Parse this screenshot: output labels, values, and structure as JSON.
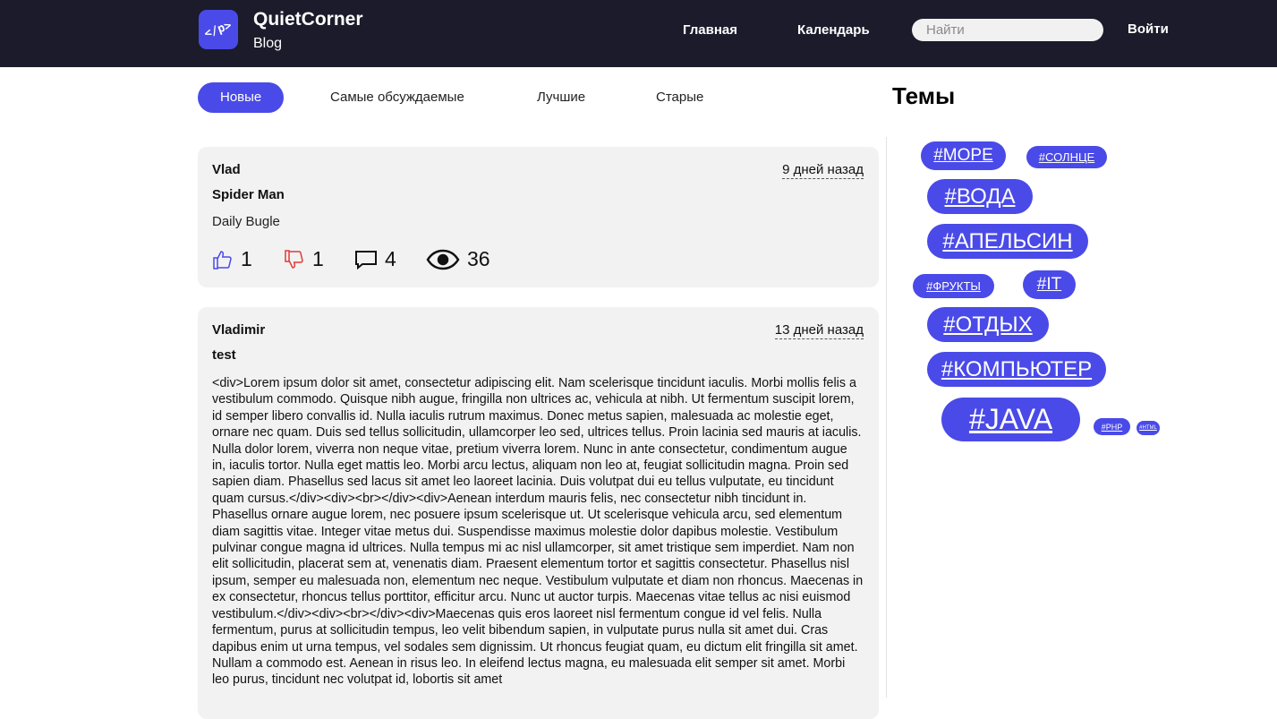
{
  "header": {
    "logo_text": "</p>",
    "brand_title": "QuietCorner",
    "brand_sub": "Blog",
    "nav": {
      "home": "Главная",
      "calendar": "Календарь",
      "login": "Войти"
    },
    "search_placeholder": "Найти"
  },
  "tabs": [
    "Новые",
    "Самые обсуждаемые",
    "Лучшие",
    "Старые"
  ],
  "sidebar": {
    "title": "Темы",
    "tags": [
      "#МОРЕ",
      "#СОЛНЦЕ",
      "#ВОДА",
      "#АПЕЛЬСИН",
      "#ФРУКТЫ",
      "#IT",
      "#ОТДЫХ",
      "#КОМПЬЮТЕР",
      "#JAVA",
      "#PHP",
      "#HTML"
    ]
  },
  "posts": [
    {
      "author": "Vlad",
      "date": "9 дней назад",
      "title": "Spider Man",
      "body": "Daily Bugle",
      "likes": "1",
      "dislikes": "1",
      "comments": "4",
      "views": "36"
    },
    {
      "author": "Vladimir",
      "date": "13 дней назад",
      "title": "test",
      "body": "<div>Lorem ipsum dolor sit amet, consectetur adipiscing elit. Nam scelerisque tincidunt iaculis. Morbi mollis felis a vestibulum commodo. Quisque nibh augue, fringilla non ultrices ac, vehicula at nibh. Ut fermentum suscipit lorem, id semper libero convallis id. Nulla iaculis rutrum maximus. Donec metus sapien, malesuada ac molestie eget, ornare nec quam. Duis sed tellus sollicitudin, ullamcorper leo sed, ultrices tellus. Proin lacinia sed mauris at iaculis. Nulla dolor lorem, viverra non neque vitae, pretium viverra lorem. Nunc in ante consectetur, condimentum augue in, iaculis tortor. Nulla eget mattis leo. Morbi arcu lectus, aliquam non leo at, feugiat sollicitudin magna. Proin sed sapien diam. Phasellus sed lacus sit amet leo laoreet lacinia. Duis volutpat dui eu tellus vulputate, eu tincidunt quam cursus.</div><div><br></div><div>Aenean interdum mauris felis, nec consectetur nibh tincidunt in. Phasellus ornare augue lorem, nec posuere ipsum scelerisque ut. Ut scelerisque vehicula arcu, sed elementum diam sagittis vitae. Integer vitae metus dui. Suspendisse maximus molestie dolor dapibus molestie. Vestibulum pulvinar congue magna id ultrices. Nulla tempus mi ac nisl ullamcorper, sit amet tristique sem imperdiet. Nam non elit sollicitudin, placerat sem at, venenatis diam. Praesent elementum tortor et sagittis consectetur. Phasellus nisl ipsum, semper eu malesuada non, elementum nec neque. Vestibulum vulputate et diam non rhoncus. Maecenas in ex consectetur, rhoncus tellus porttitor, efficitur arcu. Nunc ut auctor turpis. Maecenas vitae tellus ac nisi euismod vestibulum.</div><div><br></div><div>Maecenas quis eros laoreet nisl fermentum congue id vel felis. Nulla fermentum, purus at sollicitudin tempus, leo velit bibendum sapien, in vulputate purus nulla sit amet dui. Cras dapibus enim ut urna tempus, vel sodales sem dignissim. Ut rhoncus feugiat quam, eu dictum elit fringilla sit amet. Nullam a commodo est. Aenean in risus leo. In eleifend lectus magna, eu malesuada elit semper sit amet. Morbi leo purus, tincidunt nec volutpat id, lobortis sit amet"
    }
  ],
  "colors": {
    "accent": "#4a4ae8",
    "header_bg": "#1b1b2b",
    "card_bg": "#f2f2f2",
    "dislike": "#e03a3a"
  }
}
